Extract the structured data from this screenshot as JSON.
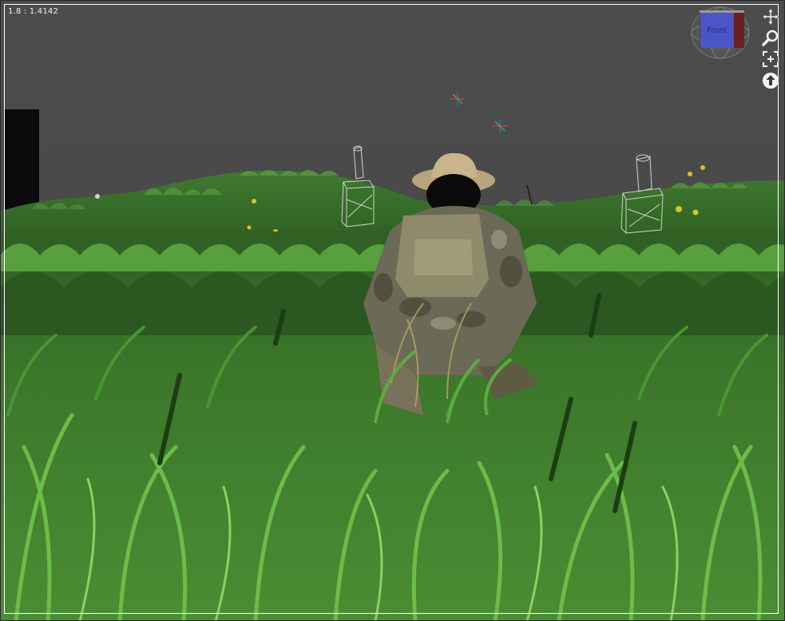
{
  "viewport": {
    "aspect_readout": "1.8 : 1.4142",
    "view_cube": {
      "face_label": "Front",
      "face_color": "#4a55c8"
    },
    "nav_tools": [
      {
        "name": "pan-tool",
        "icon": "move-arrows-icon"
      },
      {
        "name": "zoom-tool",
        "icon": "magnifier-icon"
      },
      {
        "name": "zoom-extents-tool",
        "icon": "zoom-extents-icon"
      },
      {
        "name": "orbit-tool",
        "icon": "up-arrow-circle-icon"
      }
    ]
  },
  "colors": {
    "sky": "#4a4a4a",
    "grass_dark": "#1f4a16",
    "grass_mid": "#3c7d2a",
    "grass_light": "#6cb94b",
    "frame": "#ffffff"
  }
}
